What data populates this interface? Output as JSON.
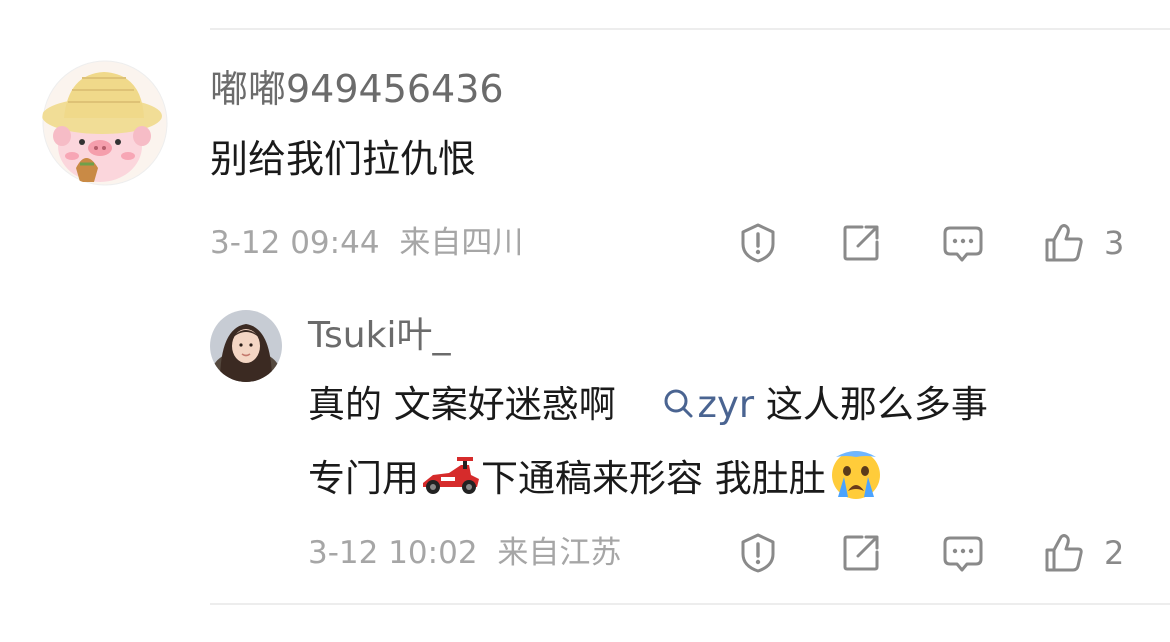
{
  "comment": {
    "username": "嘟嘟949456436",
    "text": "别给我们拉仇恨",
    "time": "3-12 09:44",
    "location": "来自四川",
    "likes": "3"
  },
  "reply": {
    "username": "Tsuki叶_",
    "line1_a": "真的 文案好迷惑啊",
    "mention": "zyr",
    "line1_b": "这人那么多事",
    "line2_a": "专门用",
    "line2_b": "下通稿来形容 我肚肚",
    "time": "3-12 10:02",
    "location": "来自江苏",
    "likes": "2"
  },
  "icons": {
    "report": "shield-exclamation-icon",
    "share": "share-arrow-icon",
    "reply": "comment-bubble-icon",
    "like": "thumbs-up-icon",
    "mention": "search-icon",
    "emoji1": "race-car-emoji",
    "emoji2": "crying-face-emoji"
  },
  "colors": {
    "username": "#6b6b6b",
    "text": "#1a1a1a",
    "meta": "#a6a6a6",
    "mention": "#4a6491",
    "divider": "#ededed"
  }
}
